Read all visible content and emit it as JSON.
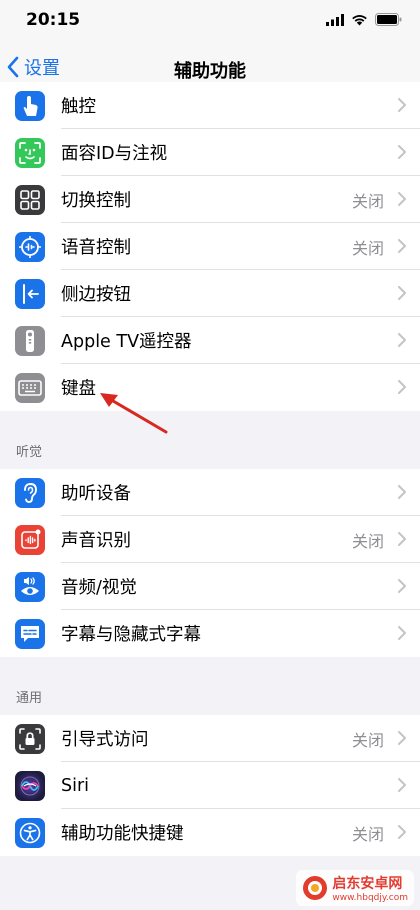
{
  "status": {
    "time": "20:15"
  },
  "nav": {
    "back_label": "设置",
    "title": "辅助功能"
  },
  "sections": {
    "vision_motor": {
      "items": [
        {
          "label": "触控",
          "value": "",
          "icon": "touch-hand-icon",
          "color": "#1a73e8"
        },
        {
          "label": "面容ID与注视",
          "value": "",
          "icon": "face-id-icon",
          "color": "#34c759"
        },
        {
          "label": "切换控制",
          "value": "关闭",
          "icon": "switch-control-icon",
          "color": "#3a3a3c"
        },
        {
          "label": "语音控制",
          "value": "关闭",
          "icon": "voice-control-icon",
          "color": "#1a73e8"
        },
        {
          "label": "侧边按钮",
          "value": "",
          "icon": "side-button-icon",
          "color": "#1a73e8"
        },
        {
          "label": "Apple TV遥控器",
          "value": "",
          "icon": "tv-remote-icon",
          "color": "#8e8e93"
        },
        {
          "label": "键盘",
          "value": "",
          "icon": "keyboard-icon",
          "color": "#8e8e93"
        }
      ]
    },
    "hearing": {
      "header": "听觉",
      "items": [
        {
          "label": "助听设备",
          "value": "",
          "icon": "ear-icon",
          "color": "#1a73e8"
        },
        {
          "label": "声音识别",
          "value": "关闭",
          "icon": "sound-recognition-icon",
          "color": "#ea4335"
        },
        {
          "label": "音频/视觉",
          "value": "",
          "icon": "audio-visual-icon",
          "color": "#1a73e8"
        },
        {
          "label": "字幕与隐藏式字幕",
          "value": "",
          "icon": "subtitles-icon",
          "color": "#1a73e8"
        }
      ]
    },
    "general": {
      "header": "通用",
      "items": [
        {
          "label": "引导式访问",
          "value": "关闭",
          "icon": "lock-icon",
          "color": "#3a3a3c"
        },
        {
          "label": "Siri",
          "value": "",
          "icon": "siri-icon",
          "color": "#2c2c60"
        },
        {
          "label": "辅助功能快捷键",
          "value": "关闭",
          "icon": "accessibility-icon",
          "color": "#1a73e8"
        }
      ]
    }
  },
  "watermark": {
    "name": "启东安卓网",
    "url": "www.hbqdjy.com"
  }
}
